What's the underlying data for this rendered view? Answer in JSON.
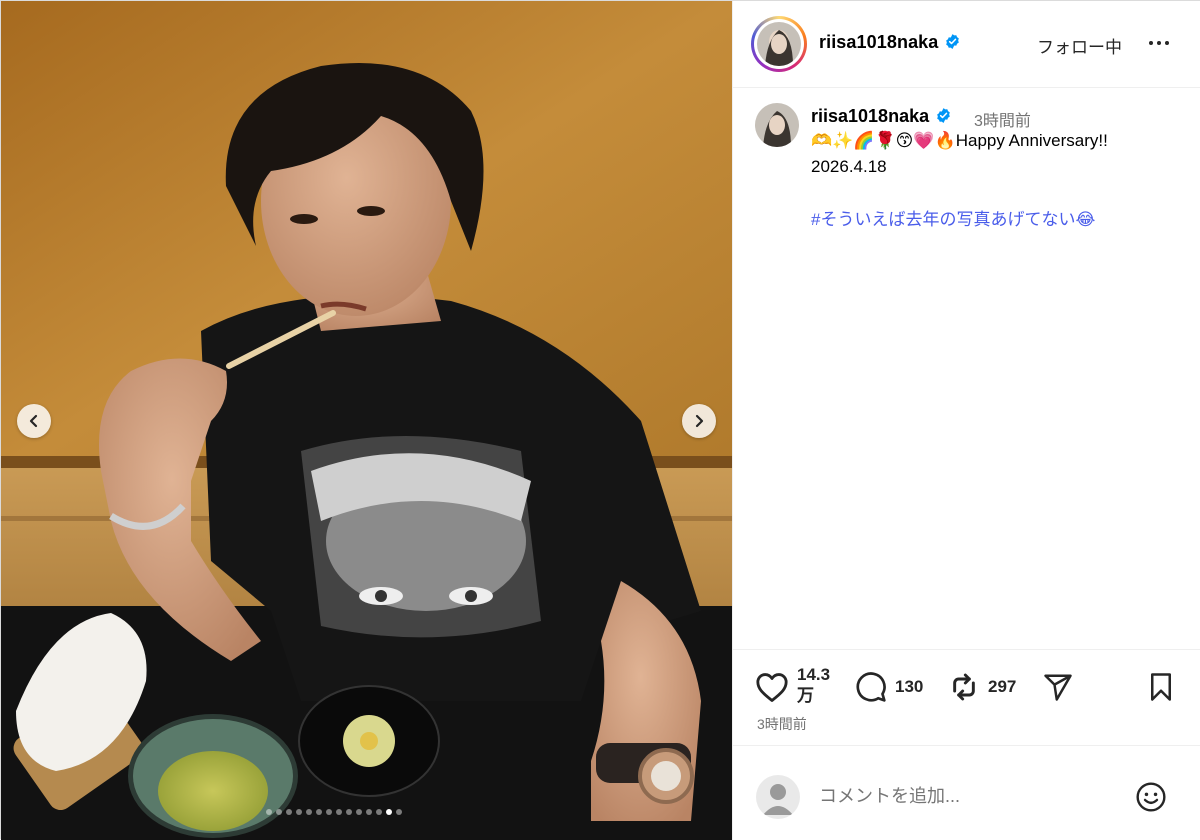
{
  "post": {
    "username": "riisa1018naka",
    "follow_label": "フォロー中",
    "caption": {
      "username": "riisa1018naka",
      "time": "3時間前",
      "emoji_line": "🫶✨🌈🌹😙💗🔥",
      "text": "Happy Anniversary!!",
      "date": "2026.4.18",
      "hashtag": "#そういえば去年の写真あげてない",
      "hashtag_emoji": "😂"
    },
    "stats": {
      "likes": "14.3万",
      "comments": "130",
      "reposts": "297"
    },
    "posted_ago": "3時間前",
    "comment_placeholder": "コメントを追加...",
    "carousel": {
      "total": 14,
      "current": 13
    }
  },
  "colors": {
    "hashtag": "#4a5dea",
    "verified": "#0095f6",
    "muted": "#737373"
  },
  "icons": [
    "verified-badge-icon",
    "more-options-icon",
    "heart-icon",
    "comment-icon",
    "repost-icon",
    "share-icon",
    "bookmark-icon",
    "emoji-icon",
    "chevron-left-icon",
    "chevron-right-icon"
  ]
}
